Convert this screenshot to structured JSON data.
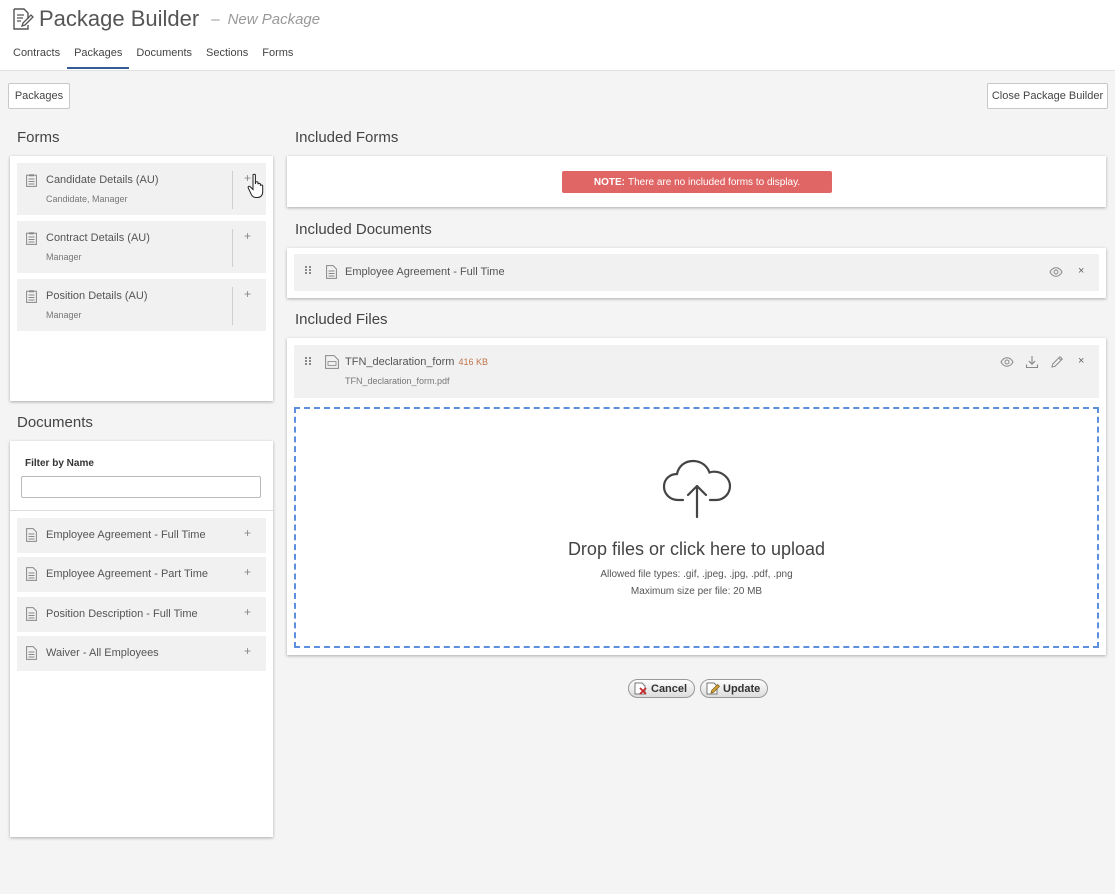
{
  "header": {
    "title": "Package Builder",
    "dash": "–",
    "subtitle": "New Package"
  },
  "tabs": [
    {
      "label": "Contracts"
    },
    {
      "label": "Packages",
      "active": true
    },
    {
      "label": "Documents"
    },
    {
      "label": "Sections"
    },
    {
      "label": "Forms"
    }
  ],
  "toolbar": {
    "packages_label": "Packages",
    "close_label": "Close Package Builder"
  },
  "forms_panel": {
    "title": "Forms",
    "items": [
      {
        "name": "Candidate Details (AU)",
        "roles": "Candidate, Manager"
      },
      {
        "name": "Contract Details (AU)",
        "roles": "Manager"
      },
      {
        "name": "Position Details (AU)",
        "roles": "Manager"
      }
    ],
    "add_symbol": "+"
  },
  "documents_panel": {
    "title": "Documents",
    "filter_label": "Filter by Name",
    "filter_value": "",
    "items": [
      {
        "name": "Employee Agreement - Full Time"
      },
      {
        "name": "Employee Agreement - Part Time"
      },
      {
        "name": "Position Description - Full Time"
      },
      {
        "name": "Waiver - All Employees"
      }
    ],
    "add_symbol": "+"
  },
  "included_forms": {
    "title": "Included Forms",
    "note_label": "NOTE:",
    "note_text": "There are no included forms to display."
  },
  "included_documents": {
    "title": "Included Documents",
    "items": [
      {
        "name": "Employee Agreement - Full Time"
      }
    ],
    "remove_symbol": "×"
  },
  "included_files": {
    "title": "Included Files",
    "items": [
      {
        "name": "TFN_declaration_form",
        "size": "416 KB",
        "filename": "TFN_declaration_form.pdf"
      }
    ],
    "remove_symbol": "×"
  },
  "dropzone": {
    "main_text": "Drop files or click here to upload",
    "types_text": "Allowed file types: .gif, .jpeg, .jpg, .pdf, .png",
    "max_text": "Maximum size per file: 20 MB"
  },
  "actions": {
    "cancel_label": "Cancel",
    "update_label": "Update"
  },
  "colors": {
    "accent": "#355d94",
    "note_bg": "#e06666",
    "dropzone_border": "#5c8fde",
    "file_size": "#c0754b"
  }
}
